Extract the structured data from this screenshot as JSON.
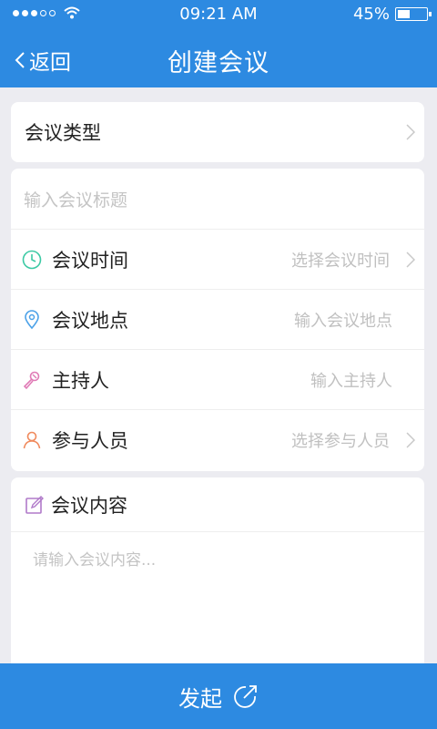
{
  "status_bar": {
    "time": "09:21 AM",
    "battery": "45%",
    "battery_level": 0.45
  },
  "nav": {
    "back_label": "返回",
    "title": "创建会议"
  },
  "meeting_type": {
    "label": "会议类型"
  },
  "title_input": {
    "placeholder": "输入会议标题"
  },
  "fields": [
    {
      "label": "会议时间",
      "hint": "选择会议时间",
      "icon": "clock-icon"
    },
    {
      "label": "会议地点",
      "hint": "输入会议地点",
      "icon": "location-pin-icon"
    },
    {
      "label": "主持人",
      "hint": "输入主持人",
      "icon": "microphone-icon"
    },
    {
      "label": "参与人员",
      "hint": "选择参与人员",
      "icon": "person-icon"
    }
  ],
  "content": {
    "label": "会议内容",
    "placeholder": "请输入会议内容..."
  },
  "launch": {
    "label": "发起"
  },
  "colors": {
    "primary": "#2d8ae1",
    "background": "#ececf1",
    "clock": "#3cc9a4",
    "pin": "#4ba1e8",
    "mic": "#e07bb6",
    "person": "#f08a5d",
    "edit": "#b07ac9"
  }
}
